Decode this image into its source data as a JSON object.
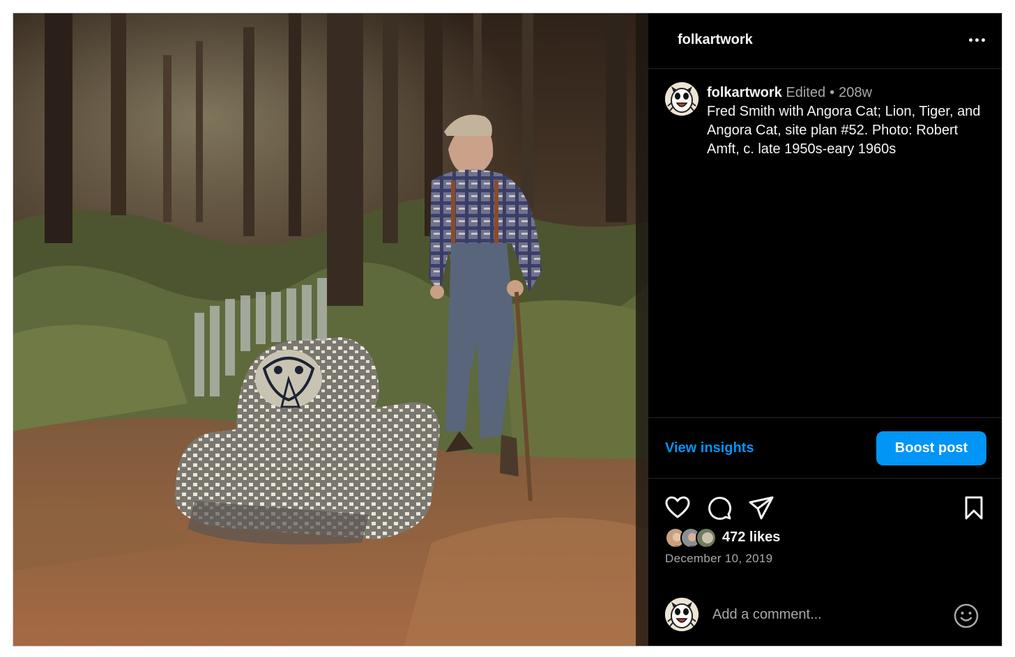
{
  "post": {
    "header_username": "folkartwork",
    "photo_alt": "Fred Smith with Angora Cat; Lion, Tiger, and Angora Cat, site plan #52. Photo: Robert Amft, c. late 1950s-eary 1960s"
  },
  "caption": {
    "username": "folkartwork",
    "edited_label": "Edited",
    "separator": "•",
    "age": "208w",
    "text": "Fred Smith with Angora Cat; Lion, Tiger, and Angora Cat, site plan #52. Photo: Robert Amft, c. late 1950s-eary 1960s"
  },
  "insights": {
    "view_label": "View insights",
    "boost_label": "Boost post"
  },
  "actions": {
    "icons": [
      "heart-icon",
      "comment-icon",
      "share-icon",
      "bookmark-icon"
    ]
  },
  "likes": {
    "count_text": "472 likes"
  },
  "date": "December 10, 2019",
  "comment": {
    "placeholder": "Add a comment...",
    "emoji_icon": "emoji-icon"
  },
  "colors": {
    "accent": "#0095f6",
    "background": "#000000",
    "muted_text": "#a8a8a8"
  }
}
